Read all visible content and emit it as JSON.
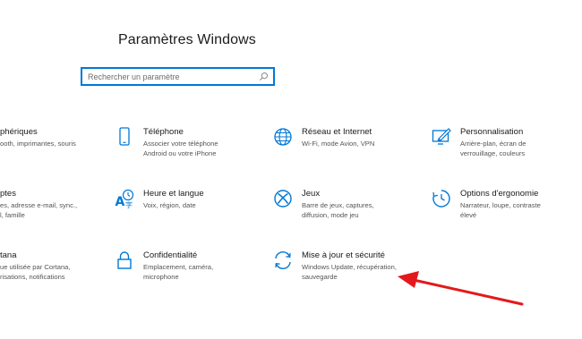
{
  "header": {
    "title": "Paramètres Windows"
  },
  "search": {
    "placeholder": "Rechercher un paramètre",
    "icon": "search-icon"
  },
  "tiles": [
    {
      "name": "phériques",
      "desc": [
        "ooth, imprimantes, souris"
      ]
    },
    {
      "name": "Téléphone",
      "desc": [
        "Associer votre téléphone",
        "Android ou votre iPhone"
      ],
      "icon": "phone-icon"
    },
    {
      "name": "Réseau et Internet",
      "desc": [
        "Wi-Fi, mode Avion, VPN"
      ],
      "icon": "globe-icon"
    },
    {
      "name": "Personnalisation",
      "desc": [
        "Arrière-plan, écran de",
        "verrouillage, couleurs"
      ],
      "icon": "paint-icon"
    },
    {
      "name": "ptes",
      "desc": [
        "es, adresse e-mail, sync.,",
        "l, famille"
      ]
    },
    {
      "name": "Heure et langue",
      "desc": [
        "Voix, région, date"
      ],
      "icon": "time-language-icon"
    },
    {
      "name": "Jeux",
      "desc": [
        "Barre de jeux, captures,",
        "diffusion, mode jeu"
      ],
      "icon": "xbox-icon"
    },
    {
      "name": "Options d'ergonomie",
      "desc": [
        "Narrateur, loupe, contraste",
        "élevé"
      ],
      "icon": "ease-of-access-icon"
    },
    {
      "name": "tana",
      "desc": [
        "ue utilisée par Cortana,",
        "risations, notifications"
      ]
    },
    {
      "name": "Confidentialité",
      "desc": [
        "Emplacement, caméra,",
        "microphone"
      ],
      "icon": "lock-icon"
    },
    {
      "name": "Mise à jour et sécurité",
      "desc": [
        "Windows Update, récupération,",
        "sauvegarde"
      ],
      "icon": "sync-icon"
    }
  ],
  "colors": {
    "accent": "#0078d7",
    "arrow": "#e3191c"
  }
}
